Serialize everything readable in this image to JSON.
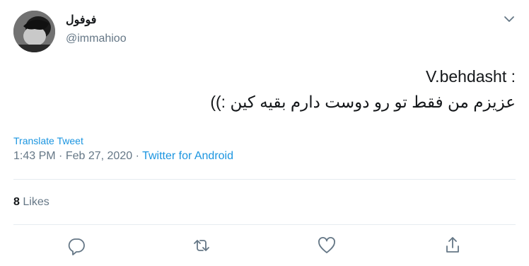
{
  "user": {
    "display_name": "فوفول",
    "handle": "@immahioo"
  },
  "tweet": {
    "lines": [
      "V.behdasht :",
      "عزیزم من فقط تو رو دوست دارم بقیه کین :))"
    ],
    "translate_label": "Translate Tweet",
    "time": "1:43 PM",
    "date": "Feb 27, 2020",
    "separator": "·",
    "source": "Twitter for Android"
  },
  "stats": {
    "likes_count": "8",
    "likes_label": "Likes"
  },
  "actions": {
    "reply_icon": "reply-icon",
    "retweet_icon": "retweet-icon",
    "like_icon": "like-icon",
    "share_icon": "share-icon"
  },
  "colors": {
    "link": "#1b95e0",
    "secondary": "#657786",
    "divider": "#e6ecf0"
  }
}
